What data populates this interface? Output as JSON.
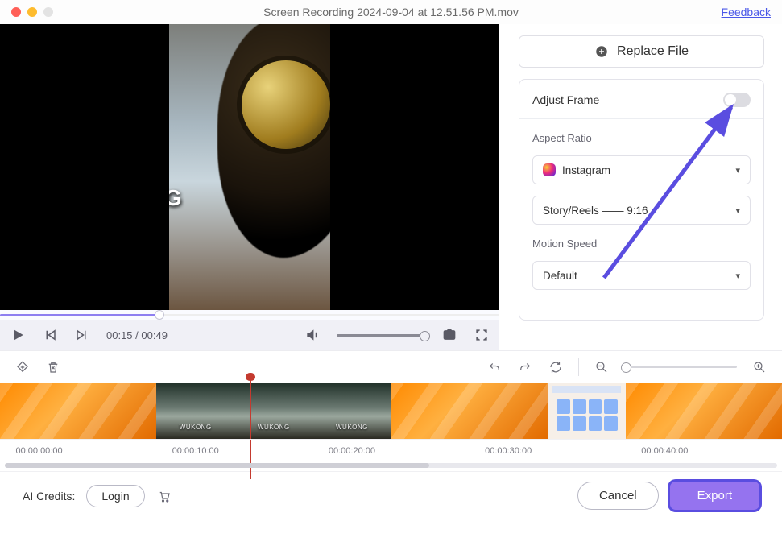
{
  "titlebar": {
    "title": "Screen Recording 2024-09-04 at 12.51.56 PM.mov",
    "feedback": "Feedback"
  },
  "video": {
    "overlay_text": "G",
    "current_time": "00:15",
    "duration": "00:49"
  },
  "panel": {
    "replace_label": "Replace File",
    "adjust_label": "Adjust Frame",
    "adjust_on": false,
    "aspect_label": "Aspect Ratio",
    "aspect_platform": "Instagram",
    "aspect_preset": "Story/Reels —— 9:16",
    "motion_label": "Motion Speed",
    "motion_value": "Default"
  },
  "timeline": {
    "clip_label_1": "WUKONG",
    "clip_label_2": "WUKONG",
    "clip_label_3": "WUKONG",
    "ticks": [
      "00:00:00:00",
      "00:00:10:00",
      "00:00:20:00",
      "00:00:30:00",
      "00:00:40:00"
    ]
  },
  "footer": {
    "credits_label": "AI Credits:",
    "login_label": "Login",
    "cancel_label": "Cancel",
    "export_label": "Export"
  },
  "icons": {
    "plus": "plus-circle-icon",
    "volume": "volume-icon",
    "snapshot": "snapshot-icon",
    "fullscreen": "fullscreen-icon",
    "diamond": "marker-diamond-icon",
    "trash": "trash-icon",
    "undo": "undo-icon",
    "redo": "redo-icon",
    "refresh": "refresh-icon",
    "zoom_out": "zoom-out-icon",
    "zoom_in": "zoom-in-icon",
    "cart": "cart-icon"
  }
}
